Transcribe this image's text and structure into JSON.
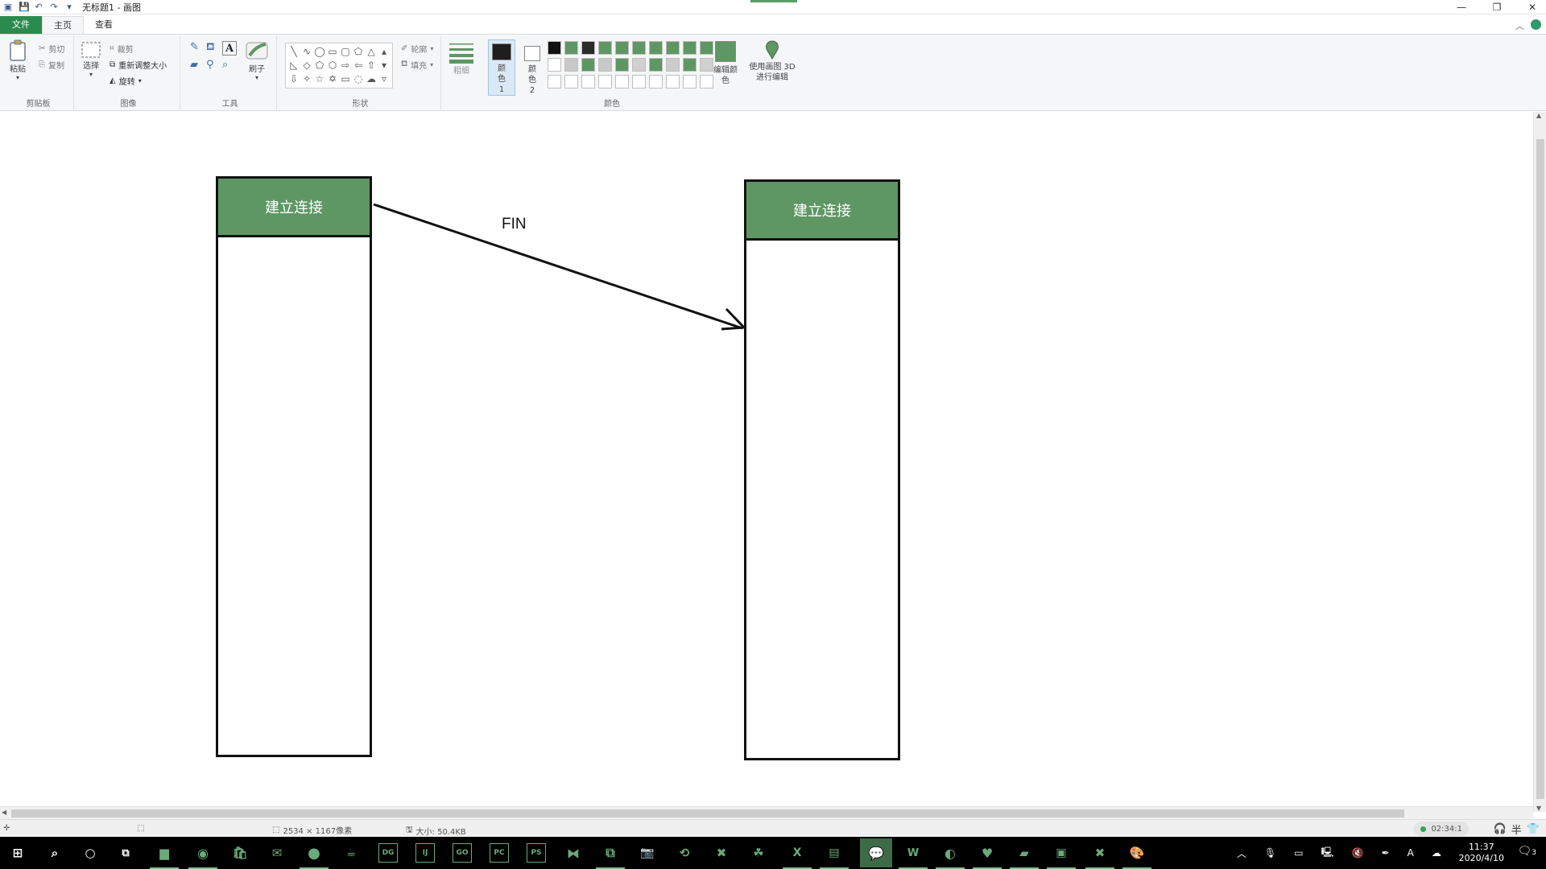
{
  "window": {
    "title": "无标题1 - 画图",
    "minimize_glyph": "—",
    "restore_glyph": "❐",
    "close_glyph": "✕"
  },
  "tabs": [
    "文件",
    "主页",
    "查看"
  ],
  "ribbon": {
    "clipboard": {
      "paste": "粘贴",
      "cut": "剪切",
      "copy": "复制",
      "label": "剪贴板"
    },
    "image": {
      "select": "选择",
      "crop": "裁剪",
      "resize": "重新调整大小",
      "rotate": "旋转",
      "label": "图像"
    },
    "tools": {
      "brush": "刷子",
      "label": "工具"
    },
    "shapes": {
      "outline": "轮廓",
      "fill": "填充",
      "label": "形状"
    },
    "size_label": "粗细",
    "color1": "颜色 1",
    "color2": "颜色 2",
    "edit_colors": "编辑颜色",
    "paint3d": "使用画图 3D 进行编辑",
    "colors_label": "颜色",
    "palette": [
      "#111111",
      "#5e9763",
      "#2a2a2a",
      "#5e9763",
      "#5e9763",
      "#5e9763",
      "#5e9763",
      "#5e9763",
      "#5e9763",
      "#5e9763",
      "#ffffff",
      "#c8c8c8",
      "#5e9763",
      "#c8c8c8",
      "#5e9763",
      "#d0d0d0",
      "#5e9763",
      "#cccccc",
      "#5e9763",
      "#d0d0d0",
      "#ffffff",
      "#ffffff",
      "#ffffff",
      "#ffffff",
      "#ffffff",
      "#ffffff",
      "#ffffff",
      "#ffffff",
      "#ffffff",
      "#ffffff"
    ]
  },
  "diagram": {
    "left_node": {
      "label": "建立连接"
    },
    "right_node": {
      "label": "建立连接"
    },
    "edge_label": "FIN",
    "header_color": "#5e9763"
  },
  "status": {
    "dimensions": "2534 × 1167像素",
    "size": "大小: 50.4KB",
    "recording_time": "02:34:1",
    "ime": "半"
  },
  "taskbar": {
    "apps": [
      "DG",
      "IJ",
      "GO",
      "PC",
      "PS"
    ],
    "time": "11:37",
    "date": "2020/4/10",
    "notifications": "3"
  }
}
